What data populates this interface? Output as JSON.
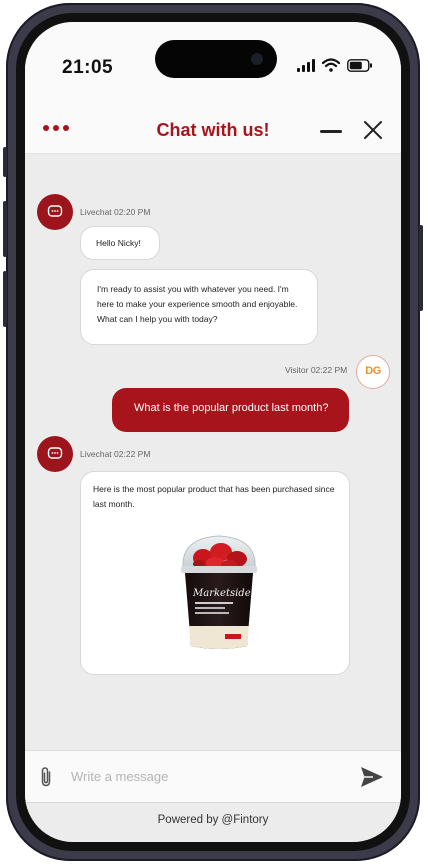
{
  "status_bar": {
    "time": "21:05"
  },
  "header": {
    "title": "Chat with us!",
    "menu_icon": "more-dots-icon",
    "minimize_icon": "minimize-icon",
    "close_icon": "close-icon"
  },
  "messages": {
    "first": {
      "sender": "Livechat 02:20 PM",
      "bubble1": "Hello Nicky!",
      "bubble2_line1": "I'm ready to assist you with whatever you need. I'm",
      "bubble2_line2": "here to make your experience smooth and enjoyable.",
      "bubble2_line3": "What can I help you with today?"
    },
    "visitor": {
      "sender": "Visitor 02:22 PM",
      "avatar_initials": "DG",
      "text": "What is the popular product last month?"
    },
    "second": {
      "sender": "Livechat 02:22 PM",
      "text_line1": "Here is the most popular product that has been purchased since",
      "text_line2": "last month.",
      "product_label": "Marketside"
    }
  },
  "composer": {
    "placeholder": "Write a message",
    "attach_icon": "paperclip-icon",
    "send_icon": "send-icon"
  },
  "footer": {
    "powered_by": "Powered by @Fintory"
  },
  "colors": {
    "accent": "#a8141c",
    "background": "#ececec"
  }
}
